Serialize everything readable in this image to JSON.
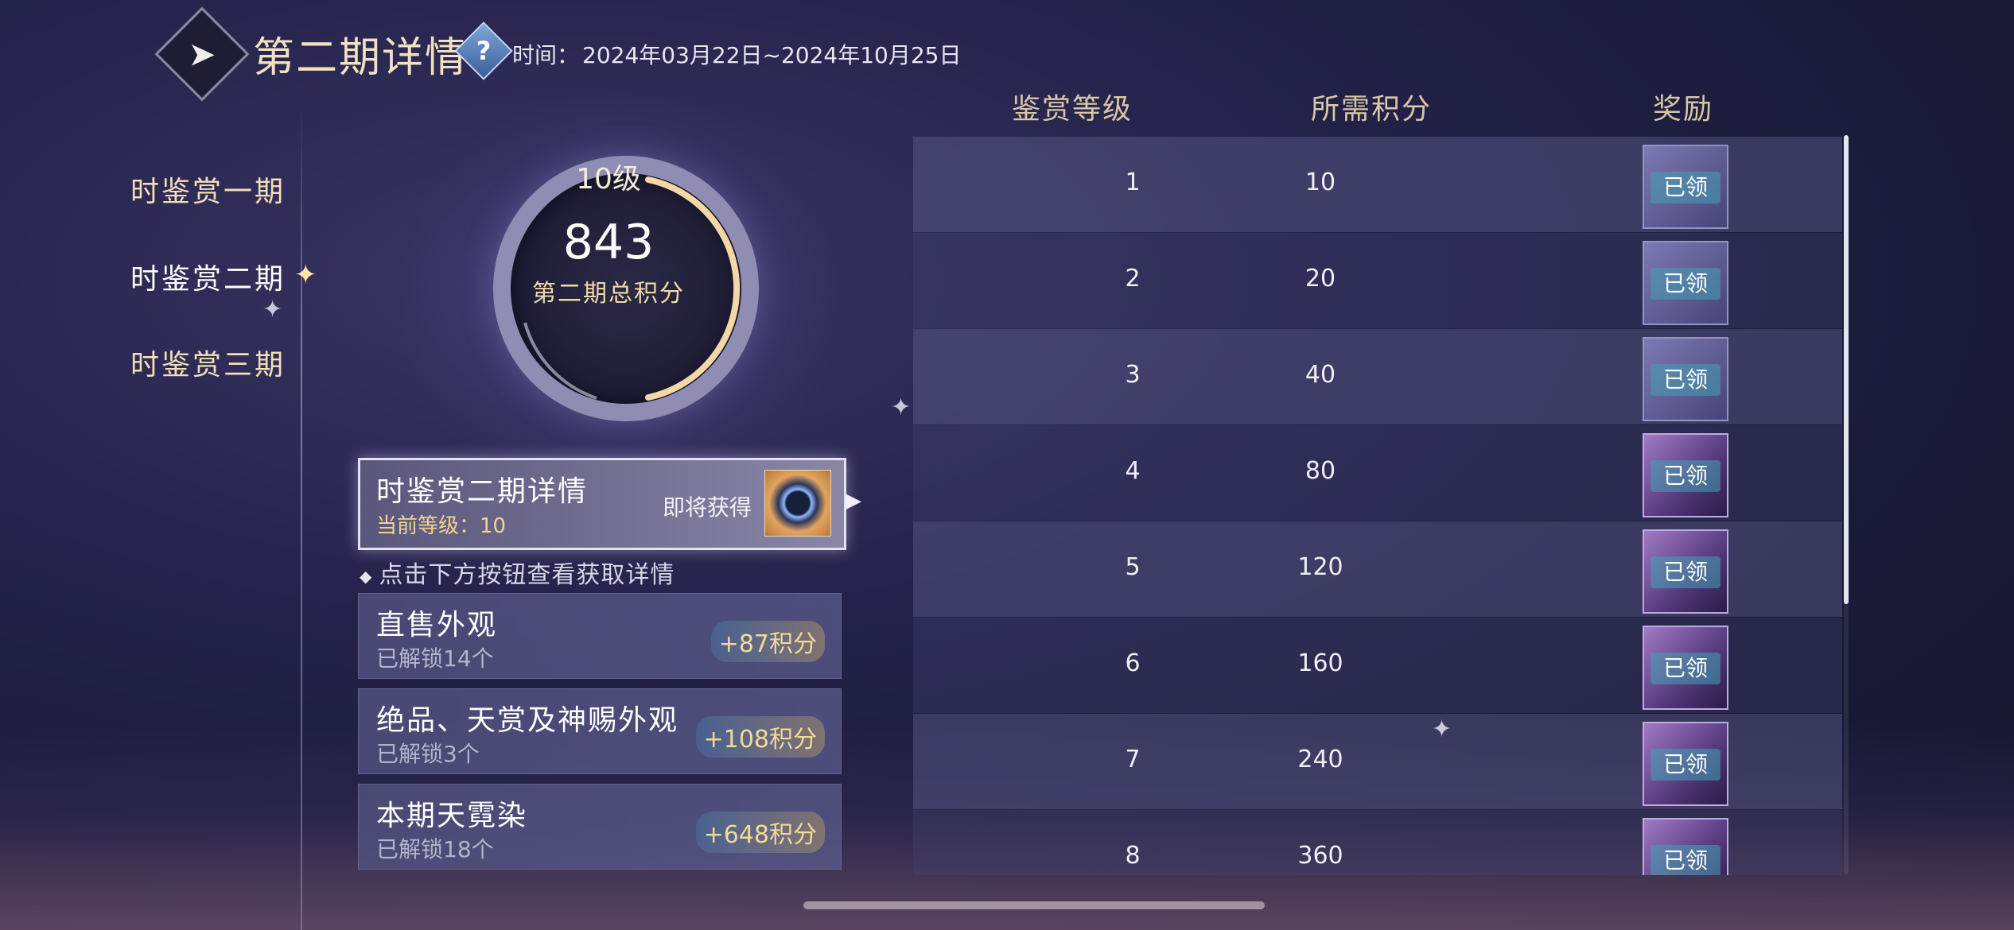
{
  "header": {
    "back_icon": "back-arrow-icon",
    "title": "第二期详情",
    "help_icon": "?",
    "time_label": "时间：",
    "time_value": "2024年03月22日~2024年10月25日"
  },
  "nav": {
    "items": [
      {
        "label": "时鉴赏一期"
      },
      {
        "label": "时鉴赏二期"
      },
      {
        "label": "时鉴赏三期"
      }
    ],
    "active_index": 1
  },
  "ring": {
    "level": "10级",
    "points": "843",
    "label": "第二期总积分"
  },
  "detail_card": {
    "title": "时鉴赏二期详情",
    "current_level": "当前等级：10",
    "upcoming": "即将获得"
  },
  "hint": "点击下方按钮查看获取详情",
  "sources": [
    {
      "name": "直售外观",
      "unlocked": "已解锁14个",
      "points": "+87积分"
    },
    {
      "name": "绝品、天赏及神赐外观",
      "unlocked": "已解锁3个",
      "points": "+108积分"
    },
    {
      "name": "本期天霓染",
      "unlocked": "已解锁18个",
      "points": "+648积分"
    }
  ],
  "table": {
    "headers": [
      "鉴赏等级",
      "所需积分",
      "奖励"
    ],
    "rows": [
      {
        "level": "1",
        "points": "10",
        "status": "已领"
      },
      {
        "level": "2",
        "points": "20",
        "status": "已领"
      },
      {
        "level": "3",
        "points": "40",
        "status": "已领"
      },
      {
        "level": "4",
        "points": "80",
        "status": "已领"
      },
      {
        "level": "5",
        "points": "120",
        "status": "已领"
      },
      {
        "level": "6",
        "points": "160",
        "status": "已领"
      },
      {
        "level": "7",
        "points": "240",
        "status": "已领"
      },
      {
        "level": "8",
        "points": "360",
        "status": "已领"
      }
    ]
  },
  "colors": {
    "accent_gold": "#f2dfb6",
    "points_gold": "#f4d894",
    "background": "#1f1e3d"
  }
}
